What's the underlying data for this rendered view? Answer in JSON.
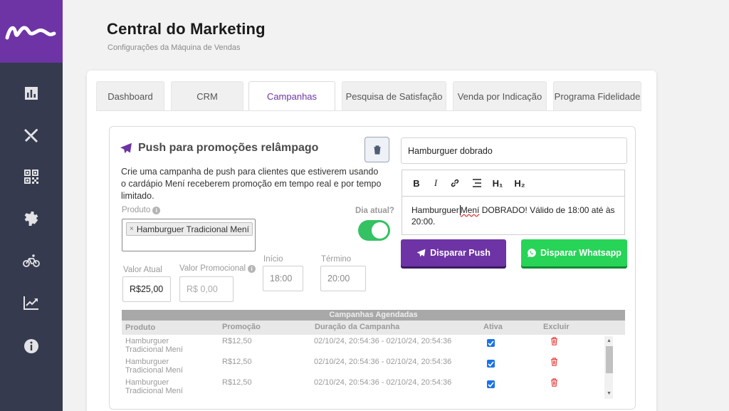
{
  "header": {
    "title": "Central do Marketing",
    "subtitle": "Configurações da Máquina de Vendas"
  },
  "sidebar": {
    "items": [
      {
        "icon": "chart-icon"
      },
      {
        "icon": "utensils-icon"
      },
      {
        "icon": "qrcode-icon"
      },
      {
        "icon": "gear-icon"
      },
      {
        "icon": "bicycle-icon"
      },
      {
        "icon": "trending-icon"
      },
      {
        "icon": "info-icon"
      }
    ]
  },
  "tabs": [
    {
      "label": "Dashboard"
    },
    {
      "label": "CRM"
    },
    {
      "label": "Campanhas"
    },
    {
      "label": "Pesquisa de Satisfação"
    },
    {
      "label": "Venda por Indicação"
    },
    {
      "label": "Programa Fidelidade"
    }
  ],
  "push": {
    "title": "Push para promoções relâmpago",
    "description": "Crie uma campanha de push para clientes que estiverem usando o cardápio Mení receberem promoção em tempo real e por tempo limitado.",
    "product_label": "Produto",
    "product_chip": "Hamburguer Tradicional Mení (",
    "chip_remove": "×",
    "dia_atual_label": "Dia atual?",
    "dia_atual_on": true,
    "valor_atual_label": "Valor Atual",
    "valor_atual_value": "R$25,00",
    "valor_promocional_label": "Valor Promocional",
    "valor_promocional_placeholder": "R$ 0,00",
    "inicio_label": "Início",
    "inicio_value": "18:00",
    "termino_label": "Término",
    "termino_value": "20:00"
  },
  "editor": {
    "campaign_name": "Hamburguer dobrado",
    "toolbar": [
      "B",
      "I",
      "link",
      "align",
      "H1",
      "H2"
    ],
    "bold_label": "B",
    "italic_label": "I",
    "h1_label": "H₁",
    "h2_label": "H₂",
    "body_part1": "Hamburguer",
    "body_spell": "Mení",
    "body_part2": " DOBRADO! Válido de 18:00 até às 20:00."
  },
  "buttons": {
    "push_label": "Disparar Push",
    "whatsapp_label": "Disparar Whatsapp"
  },
  "table": {
    "caption": "Campanhas Agendadas",
    "headers": [
      "Produto",
      "Promoção",
      "Duração da Campanha",
      "Ativa",
      "Excluir"
    ],
    "rows": [
      {
        "produto": "Hamburguer Tradicional Mení",
        "promocao": "R$12,50",
        "duracao": "02/10/24, 20:54:36 - 02/10/24, 20:54:36",
        "ativa": true
      },
      {
        "produto": "Hamburguer Tradicional Mení",
        "promocao": "R$12,50",
        "duracao": "02/10/24, 20:54:36 - 02/10/24, 20:54:36",
        "ativa": true
      },
      {
        "produto": "Hamburguer Tradicional Mení",
        "promocao": "R$12,50",
        "duracao": "02/10/24, 20:54:36 - 02/10/24, 20:54:36",
        "ativa": true
      }
    ]
  },
  "colors": {
    "brand_purple": "#6e34a6",
    "sidebar_bg": "#353a4f",
    "whatsapp_green": "#28d457",
    "toggle_green": "#34c262",
    "delete_red": "#e53935"
  }
}
